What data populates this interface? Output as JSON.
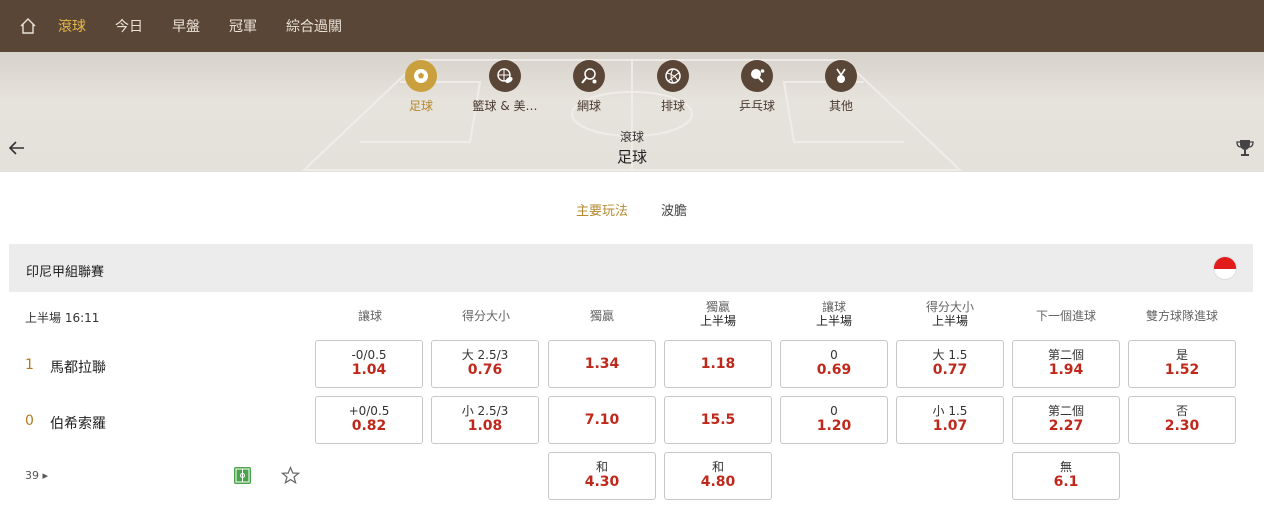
{
  "topnav": {
    "items": [
      {
        "label": "滾球",
        "active": true
      },
      {
        "label": "今日",
        "active": false
      },
      {
        "label": "早盤",
        "active": false
      },
      {
        "label": "冠軍",
        "active": false
      },
      {
        "label": "綜合過關",
        "active": false
      }
    ]
  },
  "sports": [
    {
      "label": "足球",
      "icon": "soccer-icon",
      "active": true
    },
    {
      "label": "籃球 & 美…",
      "icon": "basketball-football-icon",
      "active": false
    },
    {
      "label": "網球",
      "icon": "tennis-icon",
      "active": false
    },
    {
      "label": "排球",
      "icon": "volleyball-icon",
      "active": false
    },
    {
      "label": "乒乓球",
      "icon": "table-tennis-icon",
      "active": false
    },
    {
      "label": "其他",
      "icon": "medal-icon",
      "active": false
    }
  ],
  "header": {
    "breadcrumb": "滾球",
    "title": "足球"
  },
  "tabs": [
    {
      "label": "主要玩法",
      "active": true
    },
    {
      "label": "波膽",
      "active": false
    }
  ],
  "league": {
    "name": "印尼甲組聯賽",
    "flag_colors": [
      "#e21b1b",
      "#ffffff"
    ]
  },
  "match": {
    "time": "上半場  16:11",
    "home": {
      "score": "1",
      "name": "馬都拉聯"
    },
    "away": {
      "score": "0",
      "name": "伯希索羅"
    },
    "more_count": "39"
  },
  "columns": [
    {
      "l1": "讓球",
      "l2": ""
    },
    {
      "l1": "得分大小",
      "l2": ""
    },
    {
      "l1": "獨贏",
      "l2": ""
    },
    {
      "l1": "獨贏",
      "l2": "上半場"
    },
    {
      "l1": "讓球",
      "l2": "上半場"
    },
    {
      "l1": "得分大小",
      "l2": "上半場"
    },
    {
      "l1": "下一個進球",
      "l2": ""
    },
    {
      "l1": "雙方球隊進球",
      "l2": ""
    }
  ],
  "odds": {
    "row1": [
      {
        "top": "-0/0.5",
        "val": "1.04"
      },
      {
        "top": "大 2.5/3",
        "val": "0.76"
      },
      {
        "top": "",
        "val": "1.34"
      },
      {
        "top": "",
        "val": "1.18"
      },
      {
        "top": "0",
        "val": "0.69"
      },
      {
        "top": "大 1.5",
        "val": "0.77"
      },
      {
        "top": "第二個",
        "val": "1.94"
      },
      {
        "top": "是",
        "val": "1.52"
      }
    ],
    "row2": [
      {
        "top": "+0/0.5",
        "val": "0.82"
      },
      {
        "top": "小 2.5/3",
        "val": "1.08"
      },
      {
        "top": "",
        "val": "7.10"
      },
      {
        "top": "",
        "val": "15.5"
      },
      {
        "top": "0",
        "val": "1.20"
      },
      {
        "top": "小 1.5",
        "val": "1.07"
      },
      {
        "top": "第二個",
        "val": "2.27"
      },
      {
        "top": "否",
        "val": "2.30"
      }
    ],
    "row3": {
      "col3": {
        "top": "和",
        "val": "4.30"
      },
      "col4": {
        "top": "和",
        "val": "4.80"
      },
      "col7": {
        "top": "無",
        "val": "6.1"
      }
    }
  }
}
